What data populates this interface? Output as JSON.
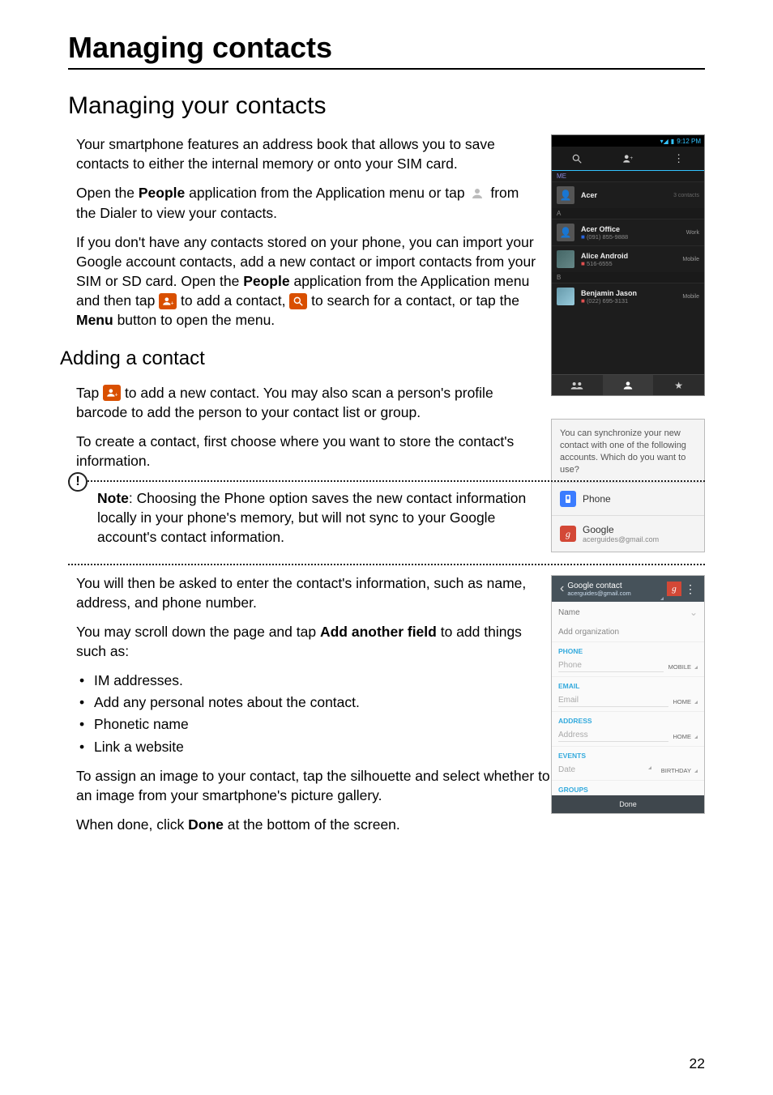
{
  "pageNumber": "22",
  "h1": "Managing contacts",
  "h2": "Managing your contacts",
  "intro1": "Your smartphone features an address book that allows you to save contacts to either the internal memory or onto your SIM card.",
  "intro2_a": "Open the ",
  "intro2_b": " application from the Application menu or tap ",
  "intro2_c": " from the Dialer to view your contacts.",
  "peopleWord": "People",
  "para3_a": "If you don't have any contacts stored on your phone, you can import your Google account contacts, add a new contact or import contacts from your SIM or SD card. Open the ",
  "para3_b": " application from the Application menu and then tap ",
  "para3_c": " to add a contact, ",
  "para3_d": " to search for a contact, or tap the ",
  "para3_e": " button to open the menu.",
  "menuWord": "Menu",
  "h3": "Adding a contact",
  "addpara1_a": "Tap ",
  "addpara1_b": " to add a new contact. You may also scan a person's profile barcode to add the person to your contact list or group.",
  "addpara2": "To create a contact, first choose where you want to store the contact's information.",
  "note_label": "Note",
  "note_body": ": Choosing the Phone option saves the new contact information locally in your phone's memory, but will not sync to your Google account's contact information.",
  "after1": "You will then be asked to enter the contact's information, such as name, address, and phone number.",
  "after2_a": "You may scroll down the page and tap ",
  "after2_bold": "Add another field",
  "after2_b": " to add things such as:",
  "bullets": {
    "b1": "IM addresses.",
    "b2": "Add any personal notes about the contact.",
    "b3": "Phonetic name",
    "b4": "Link a website"
  },
  "after3": "To assign an image to your contact, tap the silhouette and select whether to take a photo or select an image from your smartphone's picture gallery.",
  "after4_a": "When done, click ",
  "after4_bold": "Done",
  "after4_b": " at the bottom of the screen.",
  "phone1": {
    "clock": "9:12 PM",
    "me_label": "ME",
    "me_name": "Acer",
    "count": "3 contacts",
    "sectionA": "A",
    "sectionB": "B",
    "rows": {
      "r1_name": "Acer Office",
      "r1_sub": "(091) 855-9888",
      "r1_tag": "Work",
      "r2_name": "Alice Android",
      "r2_sub": "516-6555",
      "r2_tag": "Mobile",
      "r3_name": "Benjamin Jason",
      "r3_sub": "(022) 695-3131",
      "r3_tag": "Mobile"
    }
  },
  "syncBox": {
    "prompt": "You can synchronize your new contact with one of the following accounts. Which do you want to use?",
    "opt1": "Phone",
    "opt2": "Google",
    "opt2_email": "acerguides@gmail.com"
  },
  "editBox": {
    "title": "Google contact",
    "email": "acerguides@gmail.com",
    "name_ph": "Name",
    "addorg": "Add organization",
    "sec_phone": "PHONE",
    "phone_ph": "Phone",
    "phone_type": "MOBILE",
    "sec_email": "EMAIL",
    "email_ph": "Email",
    "email_type": "HOME",
    "sec_addr": "ADDRESS",
    "addr_ph": "Address",
    "addr_type": "HOME",
    "sec_events": "EVENTS",
    "date_ph": "Date",
    "date_type": "BIRTHDAY",
    "sec_groups": "GROUPS",
    "done": "Done"
  }
}
